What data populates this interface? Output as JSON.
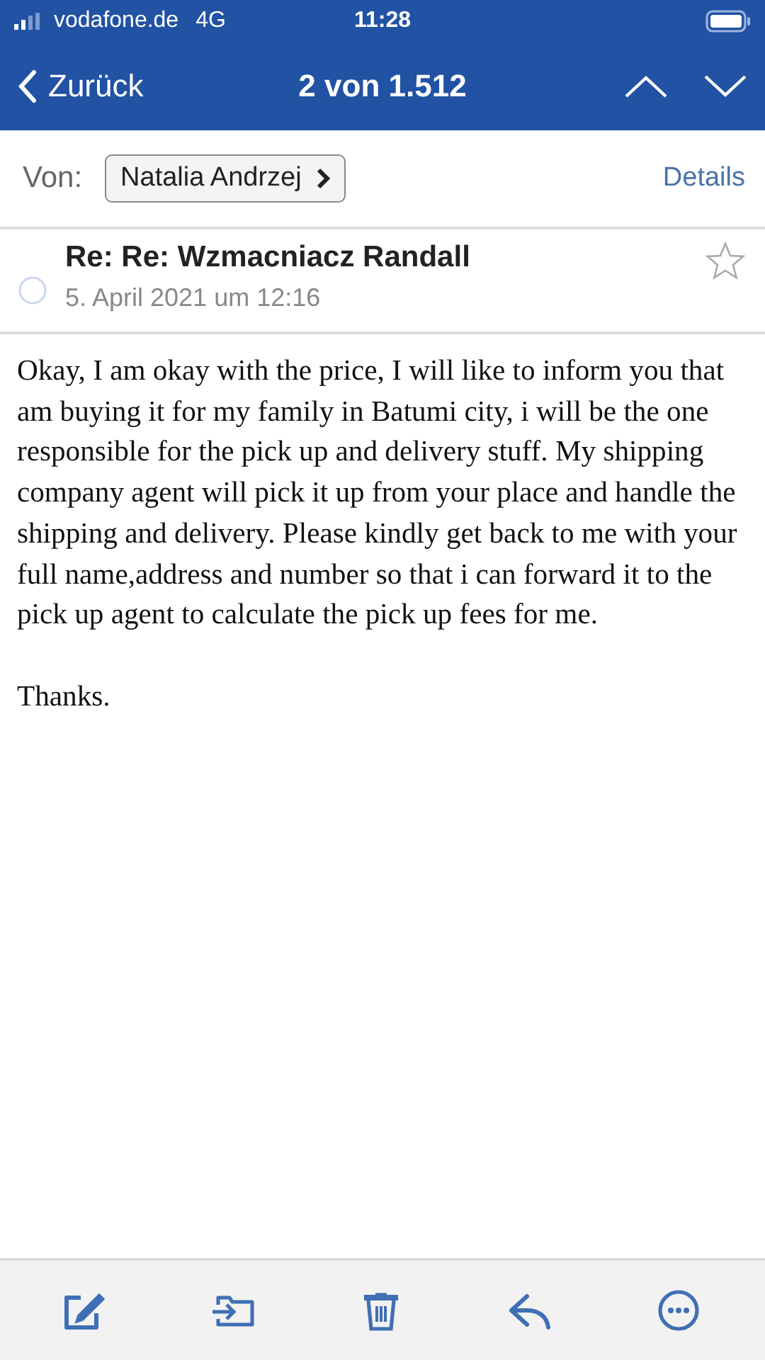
{
  "status_bar": {
    "carrier": "vodafone.de",
    "network": "4G",
    "time": "11:28"
  },
  "nav_bar": {
    "back": "Zurück",
    "position": "2 von 1.512"
  },
  "sender": {
    "label": "Von:",
    "name": "Natalia Andrzej",
    "details": "Details"
  },
  "message": {
    "subject": "Re: Re: Wzmacniacz Randall",
    "date": "5. April 2021 um 12:16",
    "unread": false,
    "starred": false,
    "paragraphs": [
      "Okay, I am okay with the price, I will like to inform you that am buying it for my family in Batumi city, i will be the one responsible for the pick up and delivery stuff. My shipping company agent will pick it up from your place and handle the shipping and delivery. Please kindly get back to me with your full name,address and number so that i can forward it to the pick up agent to calculate the pick up fees for me.",
      "Thanks."
    ]
  },
  "toolbar": [
    {
      "kind": "compose"
    },
    {
      "kind": "move"
    },
    {
      "kind": "trash"
    },
    {
      "kind": "reply"
    },
    {
      "kind": "more"
    }
  ]
}
